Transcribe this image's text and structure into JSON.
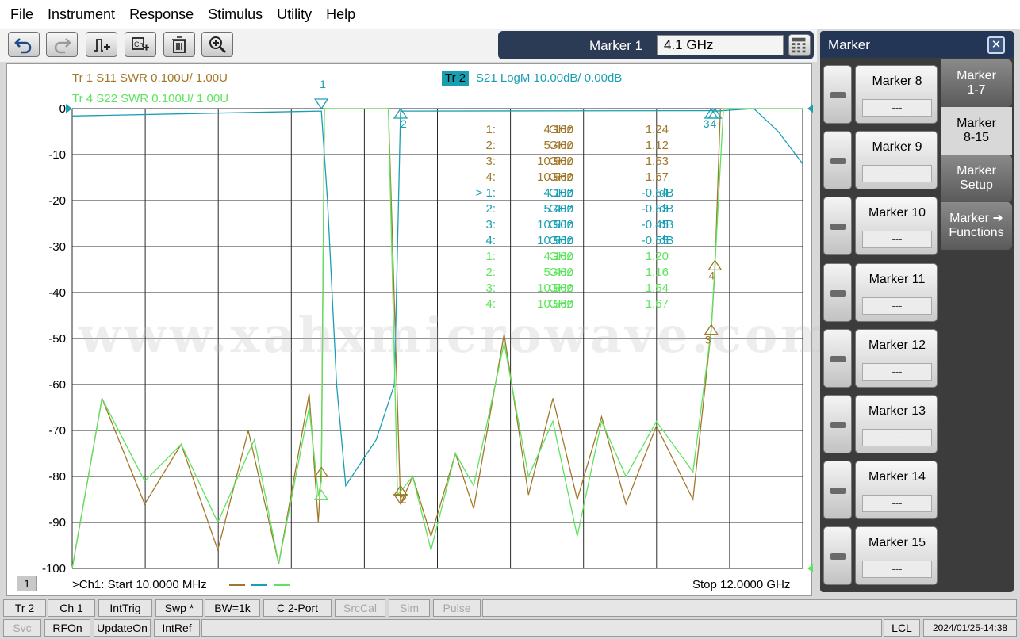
{
  "menu": [
    "File",
    "Instrument",
    "Response",
    "Stimulus",
    "Utility",
    "Help"
  ],
  "toolbar": {
    "icons": [
      "undo-icon",
      "redo-icon",
      "add-trace-icon",
      "add-channel-icon",
      "delete-icon",
      "zoom-icon"
    ]
  },
  "marker_entry": {
    "label": "Marker 1",
    "value": "4.1 GHz",
    "icon": "keypad-icon"
  },
  "traces": {
    "tr1": "Tr  1   S11 SWR 0.100U/  1.00U",
    "tr4": "Tr  4   S22 SWR 0.100U/  1.00U",
    "tr2_tag": "Tr  2",
    "tr2": "S21 LogM 10.00dB/  0.00dB"
  },
  "colors": {
    "tr1": "#a0782a",
    "tr2": "#1a9fb2",
    "tr4": "#5ee35e",
    "tr2_tag_bg": "#1a9fb2"
  },
  "watermark": "www.xahxmicrowave.com",
  "yticks": [
    "0",
    "-10",
    "-20",
    "-30",
    "-40",
    "-50",
    "-60",
    "-70",
    "-80",
    "-90",
    "-100"
  ],
  "marker_table": [
    {
      "n": "1:",
      "f": "4.100",
      "u": "GHz",
      "v": "1.24",
      "vu": "",
      "trace": "tr1"
    },
    {
      "n": "2:",
      "f": "5.400",
      "u": "GHz",
      "v": "1.12",
      "vu": "",
      "trace": "tr1"
    },
    {
      "n": "3:",
      "f": "10.500",
      "u": "GHz",
      "v": "1.53",
      "vu": "",
      "trace": "tr1"
    },
    {
      "n": "4:",
      "f": "10.560",
      "u": "GHz",
      "v": "1.67",
      "vu": "",
      "trace": "tr1"
    },
    {
      "n": "> 1:",
      "f": "4.100",
      "u": "GHz",
      "v": "-0.54",
      "vu": "dB",
      "trace": "tr2"
    },
    {
      "n": "2:",
      "f": "5.400",
      "u": "GHz",
      "v": "-0.53",
      "vu": "dB",
      "trace": "tr2"
    },
    {
      "n": "3:",
      "f": "10.500",
      "u": "GHz",
      "v": "-0.45",
      "vu": "dB",
      "trace": "tr2"
    },
    {
      "n": "4:",
      "f": "10.560",
      "u": "GHz",
      "v": "-0.55",
      "vu": "dB",
      "trace": "tr2"
    },
    {
      "n": "1:",
      "f": "4.100",
      "u": "GHz",
      "v": "1.20",
      "vu": "",
      "trace": "tr4"
    },
    {
      "n": "2:",
      "f": "5.400",
      "u": "GHz",
      "v": "1.16",
      "vu": "",
      "trace": "tr4"
    },
    {
      "n": "3:",
      "f": "10.500",
      "u": "GHz",
      "v": "1.54",
      "vu": "",
      "trace": "tr4"
    },
    {
      "n": "4:",
      "f": "10.560",
      "u": "GHz",
      "v": "1.67",
      "vu": "",
      "trace": "tr4"
    }
  ],
  "marker_tags": [
    "1",
    "2",
    "3",
    "4",
    "2",
    "3",
    "4"
  ],
  "channel": {
    "number": "1",
    "start": ">Ch1:  Start   10.0000 MHz",
    "stop": "Stop  12.0000 GHz"
  },
  "panel": {
    "title": "Marker",
    "close": "✕",
    "markers": [
      {
        "label": "Marker 8",
        "value": "---"
      },
      {
        "label": "Marker 9",
        "value": "---"
      },
      {
        "label": "Marker 10",
        "value": "---"
      },
      {
        "label": "Marker 11",
        "value": "---"
      },
      {
        "label": "Marker 12",
        "value": "---"
      },
      {
        "label": "Marker 13",
        "value": "---"
      },
      {
        "label": "Marker 14",
        "value": "---"
      },
      {
        "label": "Marker 15",
        "value": "---"
      }
    ],
    "tabs": [
      "Marker\n1-7",
      "Marker\n8-15",
      "Marker\nSetup",
      "Marker ➜\nFunctions"
    ]
  },
  "status1": [
    "Tr 2",
    "Ch 1",
    "IntTrig",
    "Swp *",
    "BW=1k",
    "C  2-Port",
    "SrcCal",
    "Sim",
    "Pulse"
  ],
  "status2": [
    "Svc",
    "RFOn",
    "UpdateOn",
    "IntRef",
    "LCL",
    "2024/01/25-14:38"
  ],
  "chart_data": {
    "type": "line",
    "x_unit": "GHz",
    "xlim": [
      0.01,
      12.0
    ],
    "ylim": [
      -100,
      0
    ],
    "grid": true,
    "series": [
      {
        "name": "S11 SWR",
        "points": [
          [
            0.01,
            -100
          ],
          [
            0.5,
            -63
          ],
          [
            1.2,
            -86
          ],
          [
            1.8,
            -73
          ],
          [
            2.4,
            -96
          ],
          [
            2.9,
            -70
          ],
          [
            3.4,
            -99
          ],
          [
            3.9,
            -62
          ],
          [
            4.05,
            -90
          ],
          [
            4.1,
            -78
          ],
          [
            4.15,
            0
          ],
          [
            4.3,
            0
          ],
          [
            5.2,
            0
          ],
          [
            5.4,
            -86
          ],
          [
            5.6,
            -80
          ],
          [
            5.9,
            -93
          ],
          [
            6.3,
            -75
          ],
          [
            6.6,
            -87
          ],
          [
            7.1,
            -49
          ],
          [
            7.5,
            -84
          ],
          [
            7.9,
            -63
          ],
          [
            8.3,
            -85
          ],
          [
            8.7,
            -67
          ],
          [
            9.1,
            -86
          ],
          [
            9.6,
            -69
          ],
          [
            10.2,
            -85
          ],
          [
            10.5,
            -48
          ],
          [
            10.56,
            -35
          ],
          [
            10.65,
            0
          ],
          [
            12.0,
            0
          ]
        ]
      },
      {
        "name": "S21 LogM",
        "points": [
          [
            0.01,
            -1.6
          ],
          [
            4.1,
            -0.54
          ],
          [
            4.2,
            -20
          ],
          [
            4.35,
            -60
          ],
          [
            4.5,
            -82
          ],
          [
            5.0,
            -72
          ],
          [
            5.3,
            -60
          ],
          [
            5.4,
            -0.53
          ],
          [
            10.5,
            -0.45
          ],
          [
            10.56,
            -0.55
          ],
          [
            11.2,
            0
          ],
          [
            11.6,
            -5
          ],
          [
            12.0,
            -12
          ]
        ]
      },
      {
        "name": "S22 SWR",
        "points": [
          [
            0.01,
            -100
          ],
          [
            0.5,
            -63
          ],
          [
            1.2,
            -81
          ],
          [
            1.8,
            -73
          ],
          [
            2.4,
            -90
          ],
          [
            3.0,
            -72
          ],
          [
            3.4,
            -99
          ],
          [
            3.9,
            -65
          ],
          [
            4.05,
            -84
          ],
          [
            4.1,
            -81
          ],
          [
            4.15,
            0
          ],
          [
            5.2,
            0
          ],
          [
            5.35,
            -84
          ],
          [
            5.6,
            -80
          ],
          [
            5.9,
            -96
          ],
          [
            6.3,
            -75
          ],
          [
            6.6,
            -82
          ],
          [
            7.1,
            -51
          ],
          [
            7.5,
            -80
          ],
          [
            7.9,
            -68
          ],
          [
            8.3,
            -93
          ],
          [
            8.7,
            -68
          ],
          [
            9.1,
            -80
          ],
          [
            9.6,
            -68
          ],
          [
            10.2,
            -79
          ],
          [
            10.5,
            -48
          ],
          [
            10.56,
            -34
          ],
          [
            10.7,
            0
          ],
          [
            12.0,
            0
          ]
        ]
      }
    ]
  }
}
